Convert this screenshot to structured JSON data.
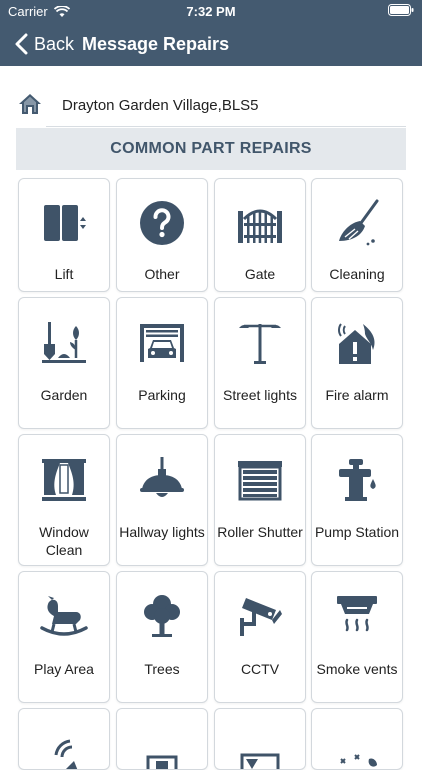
{
  "status_bar": {
    "carrier": "Carrier",
    "time": "7:32 PM"
  },
  "nav": {
    "back_label": "Back",
    "title": "Message Repairs"
  },
  "address": {
    "text": "Drayton Garden Village,BLS5"
  },
  "section": {
    "title": "COMMON PART REPAIRS"
  },
  "tiles": [
    {
      "label": "Lift",
      "icon": "lift-icon"
    },
    {
      "label": "Other",
      "icon": "question-icon"
    },
    {
      "label": "Gate",
      "icon": "gate-icon"
    },
    {
      "label": "Cleaning",
      "icon": "broom-icon"
    },
    {
      "label": "Garden",
      "icon": "garden-icon"
    },
    {
      "label": "Parking",
      "icon": "parking-icon"
    },
    {
      "label": "Street lights",
      "icon": "street-light-icon"
    },
    {
      "label": "Fire alarm",
      "icon": "fire-alarm-icon"
    },
    {
      "label": "Window Clean",
      "icon": "window-icon"
    },
    {
      "label": "Hallway lights",
      "icon": "hallway-light-icon"
    },
    {
      "label": "Roller Shutter",
      "icon": "roller-shutter-icon"
    },
    {
      "label": "Pump Station",
      "icon": "pump-icon"
    },
    {
      "label": "Play Area",
      "icon": "rocking-horse-icon"
    },
    {
      "label": "Trees",
      "icon": "tree-icon"
    },
    {
      "label": "CCTV",
      "icon": "cctv-icon"
    },
    {
      "label": "Smoke vents",
      "icon": "smoke-vent-icon"
    }
  ],
  "colors": {
    "header": "#445a70",
    "icon": "#3f5368",
    "section_bg": "#e4e8ec"
  }
}
